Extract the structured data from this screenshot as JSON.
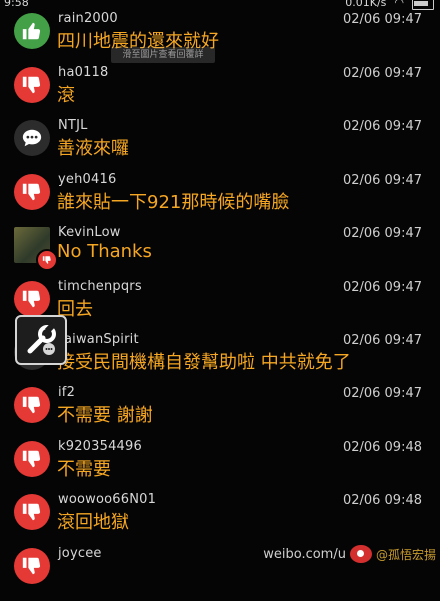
{
  "status": {
    "time": "9:58",
    "speed": "0.01K/s"
  },
  "toast": "滑至圖片查看回覆詳",
  "comments": [
    {
      "user": "rain2000",
      "time": "02/06 09:47",
      "text": "四川地震的還來就好",
      "avatar": "up"
    },
    {
      "user": "ha0118",
      "time": "02/06 09:47",
      "text": "滾",
      "avatar": "down"
    },
    {
      "user": "NTJL",
      "time": "02/06 09:47",
      "text": "善液來囉",
      "avatar": "neutral"
    },
    {
      "user": "yeh0416",
      "time": "02/06 09:47",
      "text": "誰來貼一下921那時候的嘴臉",
      "avatar": "down"
    },
    {
      "user": "KevinLow",
      "time": "02/06 09:47",
      "text": "No Thanks",
      "avatar": "photo"
    },
    {
      "user": "timchenpqrs",
      "time": "02/06 09:47",
      "text": "回去",
      "avatar": "down"
    },
    {
      "user": "TaiwanSpirit",
      "time": "02/06 09:47",
      "text": "接受民間機構自發幫助啦 中共就免了",
      "avatar": "neutral"
    },
    {
      "user": "if2",
      "time": "02/06 09:47",
      "text": "不需要  謝謝",
      "avatar": "down"
    },
    {
      "user": "k920354496",
      "time": "02/06 09:48",
      "text": "不需要",
      "avatar": "down"
    },
    {
      "user": "woowoo66N01",
      "time": "02/06 09:48",
      "text": "滾回地獄",
      "avatar": "down"
    },
    {
      "user": "joycee",
      "time": "",
      "text": "",
      "avatar": "down"
    }
  ],
  "watermark": {
    "site": "weibo.com/u",
    "handle": "@孤悟宏揚"
  }
}
